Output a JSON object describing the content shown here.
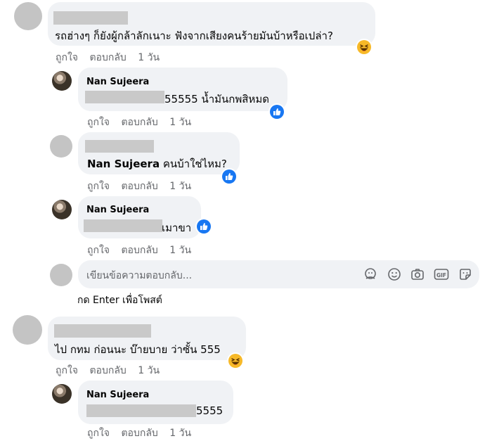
{
  "comments": [
    {
      "text": "รถฮ่างๆ ก็ยังผู้กล้าลักเนาะ ฟังจากเสียงคนร้ายมันบ้าหรือเปล่า?",
      "like": "ถูกใจ",
      "reply": "ตอบกลับ",
      "time": "1 วัน",
      "reaction": "haha-icon"
    },
    {
      "name": "Nan Sujeera",
      "text": "55555 น้ำมันกพสิหมด",
      "like": "ถูกใจ",
      "reply": "ตอบกลับ",
      "time": "1 วัน",
      "reaction": "like-icon"
    },
    {
      "mention": "Nan Sujeera",
      "text": "คนบ้าใช่ไหม?",
      "like": "ถูกใจ",
      "reply": "ตอบกลับ",
      "time": "1 วัน",
      "reaction": "like-icon"
    },
    {
      "name": "Nan Sujeera",
      "text": "เมาขา",
      "like": "ถูกใจ",
      "reply": "ตอบกลับ",
      "time": "1 วัน",
      "reaction": "like-icon"
    },
    {
      "text": "ไป กทม ก่อนนะ บ๊ายบาย ว่าซั้น 555",
      "like": "ถูกใจ",
      "reply": "ตอบกลับ",
      "time": "1 วัน",
      "reaction": "haha-icon"
    },
    {
      "name": "Nan Sujeera",
      "text": "5555",
      "like": "ถูกใจ",
      "reply": "ตอบกลับ",
      "time": "1 วัน"
    }
  ],
  "reply_box": {
    "placeholder": "เขียนข้อความตอบกลับ...",
    "hint_prefix": "กด Enter ",
    "hint_suffix": "เพื่อโพสต์",
    "icons": [
      "avatar-sticker-icon",
      "emoji-icon",
      "camera-icon",
      "gif-icon",
      "sticker-icon"
    ]
  },
  "colors": {
    "bubble": "#f0f2f5",
    "meta_text": "#65676b",
    "like_blue": "#1877f2",
    "haha_yellow": "#f7b928"
  }
}
